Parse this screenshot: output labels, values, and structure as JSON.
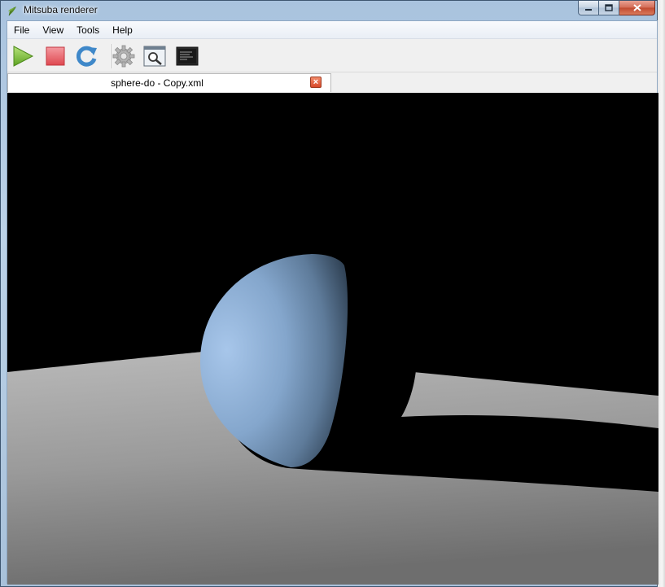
{
  "window": {
    "title": "Mitsuba renderer",
    "controls": {
      "minimize": "minimize-icon",
      "maximize": "maximize-icon",
      "close": "close-icon"
    }
  },
  "menu": [
    "File",
    "View",
    "Tools",
    "Help"
  ],
  "toolbar": {
    "buttons": [
      {
        "name": "render-button",
        "icon": "play-icon",
        "color": "#7cc23a"
      },
      {
        "name": "stop-button",
        "icon": "stop-icon",
        "color": "#e8575d"
      },
      {
        "name": "refresh-button",
        "icon": "refresh-icon",
        "color": "#3f88c9"
      },
      {
        "name": "settings-button",
        "icon": "gear-icon",
        "color": "#9a9a9a"
      },
      {
        "name": "preview-button",
        "icon": "magnifier-icon",
        "color": "#5f7d99"
      },
      {
        "name": "log-button",
        "icon": "terminal-icon",
        "color": "#2c2c2c"
      }
    ]
  },
  "tabs": [
    {
      "label": "sphere-do - Copy.xml",
      "active": true
    }
  ],
  "render": {
    "content": "rendered scene: blue-gray sphere resting on curved gray ground plane, black background",
    "sphere_color": "#8fb1d6",
    "ground_color": "#9c9c9c",
    "background_color": "#000000"
  }
}
